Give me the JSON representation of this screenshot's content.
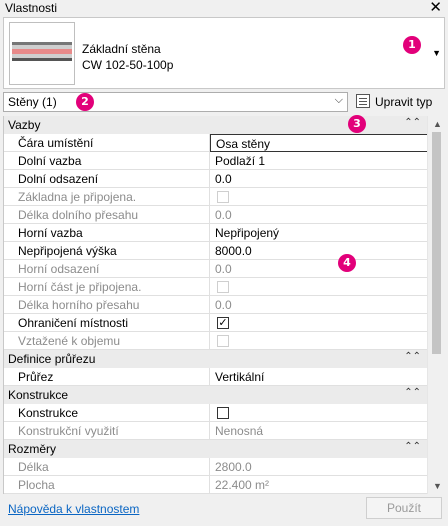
{
  "window": {
    "title": "Vlastnosti",
    "close_glyph": "✕"
  },
  "type_selector": {
    "line1": "Základní stěna",
    "line2": "CW 102-50-100p",
    "arrow": "▼"
  },
  "filter": {
    "value": "Stěny (1)",
    "arrow": "⌵"
  },
  "edit_type": {
    "label": "Upravit typ",
    "icon": "edit-type-icon"
  },
  "badges": [
    "1",
    "2",
    "3",
    "4"
  ],
  "groups": {
    "vazby": {
      "label": "Vazby",
      "chevron": "⌃⌃"
    },
    "definice": {
      "label": "Definice průřezu",
      "chevron": "⌃⌃"
    },
    "konstrukce": {
      "label": "Konstrukce",
      "chevron": "⌃⌃"
    },
    "rozmery": {
      "label": "Rozměry",
      "chevron": "⌃⌃"
    }
  },
  "params": {
    "cara": {
      "name": "Čára umístění",
      "value": "Osa stěny"
    },
    "dolni_vazba": {
      "name": "Dolní vazba",
      "value": "Podlaží 1"
    },
    "dolni_odsazeni": {
      "name": "Dolní odsazení",
      "value": "0.0"
    },
    "zakladna": {
      "name": "Základna je připojena."
    },
    "delka_dolniho": {
      "name": "Délka dolního přesahu",
      "value": "0.0"
    },
    "horni_vazba": {
      "name": "Horní vazba",
      "value": "Nepřipojený"
    },
    "nepripojena": {
      "name": "Nepřipojená výška",
      "value": "8000.0"
    },
    "horni_odsazeni": {
      "name": "Horní odsazení",
      "value": "0.0"
    },
    "horni_cast": {
      "name": "Horní část je připojena."
    },
    "delka_horniho": {
      "name": "Délka horního přesahu",
      "value": "0.0"
    },
    "ohraniceni": {
      "name": "Ohraničení místnosti",
      "checked": "✓"
    },
    "vztazene": {
      "name": "Vztažené k objemu"
    },
    "prurez": {
      "name": "Průřez",
      "value": "Vertikální"
    },
    "konstrukce": {
      "name": "Konstrukce"
    },
    "konstrukcni_vyuziti": {
      "name": "Konstrukční využití",
      "value": "Nenosná"
    },
    "delka": {
      "name": "Délka",
      "value": "2800.0"
    },
    "plocha": {
      "name": "Plocha",
      "value": "22.400 m²"
    }
  },
  "footer": {
    "help_link": "Nápověda k vlastnostem",
    "apply": "Použít"
  },
  "scrollbar": {
    "up": "▲",
    "down": "▼"
  },
  "colors": {
    "badge": "#e2007a",
    "link": "#0b66c3",
    "group_bg": "#ebebeb"
  }
}
